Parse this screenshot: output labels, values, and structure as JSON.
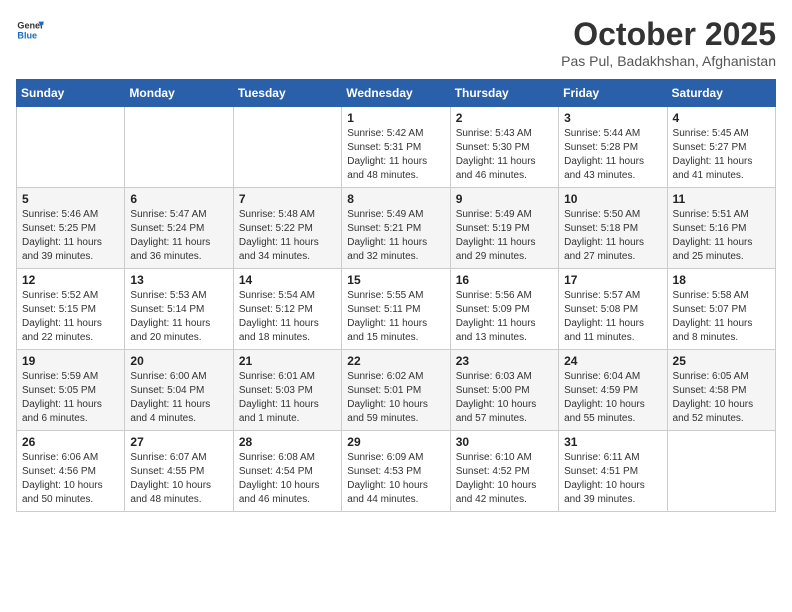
{
  "header": {
    "logo_general": "General",
    "logo_blue": "Blue",
    "month": "October 2025",
    "location": "Pas Pul, Badakhshan, Afghanistan"
  },
  "weekdays": [
    "Sunday",
    "Monday",
    "Tuesday",
    "Wednesday",
    "Thursday",
    "Friday",
    "Saturday"
  ],
  "weeks": [
    [
      {
        "day": "",
        "info": ""
      },
      {
        "day": "",
        "info": ""
      },
      {
        "day": "",
        "info": ""
      },
      {
        "day": "1",
        "info": "Sunrise: 5:42 AM\nSunset: 5:31 PM\nDaylight: 11 hours and 48 minutes."
      },
      {
        "day": "2",
        "info": "Sunrise: 5:43 AM\nSunset: 5:30 PM\nDaylight: 11 hours and 46 minutes."
      },
      {
        "day": "3",
        "info": "Sunrise: 5:44 AM\nSunset: 5:28 PM\nDaylight: 11 hours and 43 minutes."
      },
      {
        "day": "4",
        "info": "Sunrise: 5:45 AM\nSunset: 5:27 PM\nDaylight: 11 hours and 41 minutes."
      }
    ],
    [
      {
        "day": "5",
        "info": "Sunrise: 5:46 AM\nSunset: 5:25 PM\nDaylight: 11 hours and 39 minutes."
      },
      {
        "day": "6",
        "info": "Sunrise: 5:47 AM\nSunset: 5:24 PM\nDaylight: 11 hours and 36 minutes."
      },
      {
        "day": "7",
        "info": "Sunrise: 5:48 AM\nSunset: 5:22 PM\nDaylight: 11 hours and 34 minutes."
      },
      {
        "day": "8",
        "info": "Sunrise: 5:49 AM\nSunset: 5:21 PM\nDaylight: 11 hours and 32 minutes."
      },
      {
        "day": "9",
        "info": "Sunrise: 5:49 AM\nSunset: 5:19 PM\nDaylight: 11 hours and 29 minutes."
      },
      {
        "day": "10",
        "info": "Sunrise: 5:50 AM\nSunset: 5:18 PM\nDaylight: 11 hours and 27 minutes."
      },
      {
        "day": "11",
        "info": "Sunrise: 5:51 AM\nSunset: 5:16 PM\nDaylight: 11 hours and 25 minutes."
      }
    ],
    [
      {
        "day": "12",
        "info": "Sunrise: 5:52 AM\nSunset: 5:15 PM\nDaylight: 11 hours and 22 minutes."
      },
      {
        "day": "13",
        "info": "Sunrise: 5:53 AM\nSunset: 5:14 PM\nDaylight: 11 hours and 20 minutes."
      },
      {
        "day": "14",
        "info": "Sunrise: 5:54 AM\nSunset: 5:12 PM\nDaylight: 11 hours and 18 minutes."
      },
      {
        "day": "15",
        "info": "Sunrise: 5:55 AM\nSunset: 5:11 PM\nDaylight: 11 hours and 15 minutes."
      },
      {
        "day": "16",
        "info": "Sunrise: 5:56 AM\nSunset: 5:09 PM\nDaylight: 11 hours and 13 minutes."
      },
      {
        "day": "17",
        "info": "Sunrise: 5:57 AM\nSunset: 5:08 PM\nDaylight: 11 hours and 11 minutes."
      },
      {
        "day": "18",
        "info": "Sunrise: 5:58 AM\nSunset: 5:07 PM\nDaylight: 11 hours and 8 minutes."
      }
    ],
    [
      {
        "day": "19",
        "info": "Sunrise: 5:59 AM\nSunset: 5:05 PM\nDaylight: 11 hours and 6 minutes."
      },
      {
        "day": "20",
        "info": "Sunrise: 6:00 AM\nSunset: 5:04 PM\nDaylight: 11 hours and 4 minutes."
      },
      {
        "day": "21",
        "info": "Sunrise: 6:01 AM\nSunset: 5:03 PM\nDaylight: 11 hours and 1 minute."
      },
      {
        "day": "22",
        "info": "Sunrise: 6:02 AM\nSunset: 5:01 PM\nDaylight: 10 hours and 59 minutes."
      },
      {
        "day": "23",
        "info": "Sunrise: 6:03 AM\nSunset: 5:00 PM\nDaylight: 10 hours and 57 minutes."
      },
      {
        "day": "24",
        "info": "Sunrise: 6:04 AM\nSunset: 4:59 PM\nDaylight: 10 hours and 55 minutes."
      },
      {
        "day": "25",
        "info": "Sunrise: 6:05 AM\nSunset: 4:58 PM\nDaylight: 10 hours and 52 minutes."
      }
    ],
    [
      {
        "day": "26",
        "info": "Sunrise: 6:06 AM\nSunset: 4:56 PM\nDaylight: 10 hours and 50 minutes."
      },
      {
        "day": "27",
        "info": "Sunrise: 6:07 AM\nSunset: 4:55 PM\nDaylight: 10 hours and 48 minutes."
      },
      {
        "day": "28",
        "info": "Sunrise: 6:08 AM\nSunset: 4:54 PM\nDaylight: 10 hours and 46 minutes."
      },
      {
        "day": "29",
        "info": "Sunrise: 6:09 AM\nSunset: 4:53 PM\nDaylight: 10 hours and 44 minutes."
      },
      {
        "day": "30",
        "info": "Sunrise: 6:10 AM\nSunset: 4:52 PM\nDaylight: 10 hours and 42 minutes."
      },
      {
        "day": "31",
        "info": "Sunrise: 6:11 AM\nSunset: 4:51 PM\nDaylight: 10 hours and 39 minutes."
      },
      {
        "day": "",
        "info": ""
      }
    ]
  ]
}
